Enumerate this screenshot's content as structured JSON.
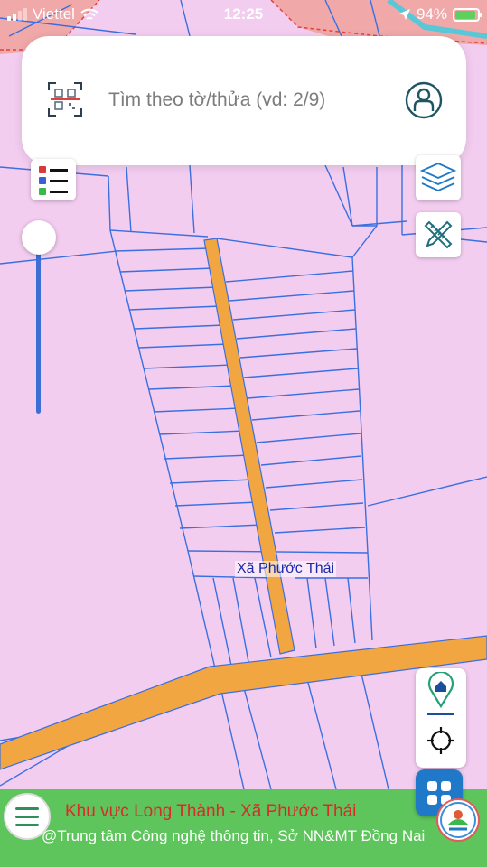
{
  "status_bar": {
    "carrier": "Viettel",
    "time": "12:25",
    "battery": "94%"
  },
  "search": {
    "placeholder": "Tìm theo tờ/thửa (vd: 2/9)",
    "value": ""
  },
  "map": {
    "place_label": "Xã Phước Thái",
    "colors": {
      "land": "#f3cdf0",
      "road": "#f2a641",
      "parcel_line": "#3a6fe0",
      "residential": "#f0a8a8",
      "water": "#58c8d8"
    }
  },
  "icons": {
    "qr": "qr-scan-icon",
    "user": "user-icon",
    "legend": "legend-icon",
    "layers": "layers-icon",
    "measure": "ruler-pencil-icon",
    "home_pin": "home-pin-icon",
    "locate": "crosshair-icon",
    "grid": "grid-icon",
    "menu": "hamburger-icon"
  },
  "footer": {
    "area": "Khu vực Long Thành - Xã Phước Thái",
    "credit": "@Trung tâm Công nghệ thông tin, Sở NN&MT Đồng Nai",
    "colors": {
      "bar": "#5ec55c",
      "area_text": "#d92a2a",
      "credit_text": "#ffffff"
    }
  },
  "zoom_slider": {
    "level": 1.0
  }
}
